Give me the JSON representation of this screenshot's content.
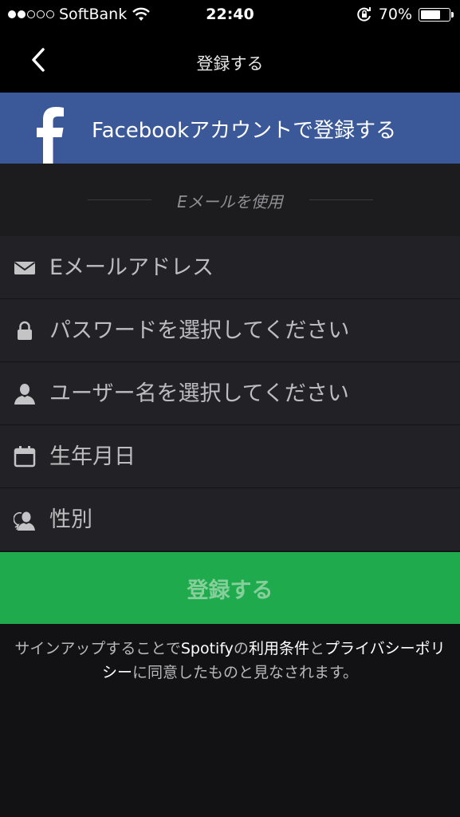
{
  "status_bar": {
    "carrier": "SoftBank",
    "time": "22:40",
    "battery_percent": "70%",
    "battery_level": 0.7,
    "signal_bars_filled": 2,
    "signal_bars_total": 5,
    "icons": [
      "wifi-icon",
      "orientation-lock-icon",
      "battery-icon"
    ]
  },
  "nav": {
    "back_icon": "chevron-left-icon",
    "title": "登録する"
  },
  "facebook": {
    "icon": "facebook-f-icon",
    "label": "Facebookアカウントで登録する",
    "color": "#3b5998"
  },
  "divider": {
    "text": "Eメールを使用"
  },
  "form": {
    "email": {
      "icon": "envelope-icon",
      "placeholder": "Eメールアドレス",
      "value": ""
    },
    "password": {
      "icon": "lock-icon",
      "placeholder": "パスワードを選択してください",
      "value": ""
    },
    "username": {
      "icon": "user-icon",
      "placeholder": "ユーザー名を選択してください",
      "value": ""
    },
    "birthday": {
      "icon": "calendar-icon",
      "placeholder": "生年月日",
      "value": ""
    },
    "gender": {
      "icon": "gender-user-icon",
      "placeholder": "性別",
      "value": ""
    }
  },
  "submit": {
    "label": "登録する",
    "color": "#1fab4d"
  },
  "terms": {
    "prefix": "サインアップすることで",
    "brand": "Spotify",
    "mid1": "の",
    "terms_link": "利用条件",
    "mid2": "と",
    "privacy_link": "プライバシーポリシー",
    "suffix": "に同意したものと見なされます。"
  }
}
